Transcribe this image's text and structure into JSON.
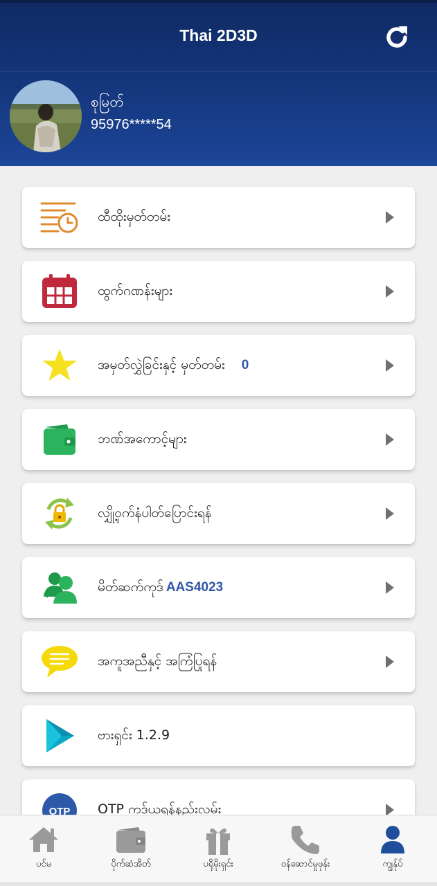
{
  "header": {
    "title": "Thai 2D3D",
    "refresh_icon": "refresh-icon"
  },
  "profile": {
    "name": "စုမြတ်",
    "phone": "95976*****54"
  },
  "menu": {
    "items": [
      {
        "label": "ထီထိုးမှတ်တမ်း",
        "icon": "clock-list-icon"
      },
      {
        "label": "ထွက်ဂဏန်းများ",
        "icon": "calendar-icon"
      },
      {
        "label": "အမှတ်လွှဲခြင်းနှင့် မှတ်တမ်း",
        "count": "0",
        "icon": "star-icon"
      },
      {
        "label": "ဘဏ်အကောင့်များ",
        "icon": "wallet-icon"
      },
      {
        "label": "လျှို့ဝှက်နံပါတ်ပြောင်းရန်",
        "icon": "lock-refresh-icon"
      },
      {
        "label": "မိတ်ဆက်ကုဒ်",
        "code": "AAS4023",
        "icon": "users-icon"
      },
      {
        "label": "အကူအညီနှင့် အကြံပြုရန်",
        "icon": "chat-icon"
      },
      {
        "label": "ဗားရှင်း 1.2.9",
        "icon": "play-icon"
      },
      {
        "label": "OTP ကုဒ်ယူရန်နည်းလမ်း",
        "icon": "otp-icon"
      }
    ]
  },
  "bottom_nav": {
    "items": [
      {
        "label": "ပင်မ",
        "icon": "home-icon"
      },
      {
        "label": "ပိုက်ဆံအိတ်",
        "icon": "wallet-icon"
      },
      {
        "label": "ပရိုမိုးရှင်း",
        "icon": "gift-icon"
      },
      {
        "label": "ဝန်ဆောင်မှုဖုန်း",
        "icon": "phone-icon"
      },
      {
        "label": "ကျွန်ုပ်",
        "icon": "user-icon"
      }
    ],
    "active_index": 4
  },
  "colors": {
    "header_top": "#0f2a63",
    "header_bottom": "#1c4699",
    "accent_blue": "#2f57a6",
    "nav_inactive": "#9a9a9a",
    "nav_active": "#1f4f9a"
  }
}
